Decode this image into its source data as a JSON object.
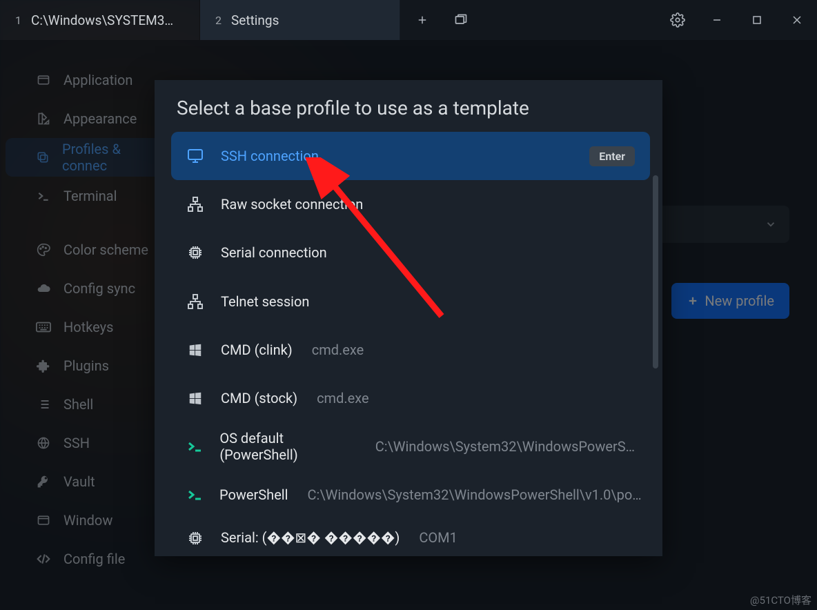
{
  "tabs": [
    {
      "index": "1",
      "label": "C:\\Windows\\SYSTEM3…"
    },
    {
      "index": "2",
      "label": "Settings"
    }
  ],
  "sidebar": {
    "items": [
      {
        "id": "application",
        "label": "Application"
      },
      {
        "id": "appearance",
        "label": "Appearance"
      },
      {
        "id": "profiles",
        "label": "Profiles & connec"
      },
      {
        "id": "terminal",
        "label": "Terminal"
      }
    ],
    "items2": [
      {
        "id": "colorscheme",
        "label": "Color scheme"
      },
      {
        "id": "configsync",
        "label": "Config sync"
      },
      {
        "id": "hotkeys",
        "label": "Hotkeys"
      },
      {
        "id": "plugins",
        "label": "Plugins"
      },
      {
        "id": "shell",
        "label": "Shell"
      },
      {
        "id": "ssh",
        "label": "SSH"
      },
      {
        "id": "vault",
        "label": "Vault"
      },
      {
        "id": "window",
        "label": "Window"
      },
      {
        "id": "configfile",
        "label": "Config file"
      }
    ]
  },
  "content": {
    "new_profile_label": "New profile"
  },
  "modal": {
    "title": "Select a base profile to use as a template",
    "enter_badge": "Enter",
    "profiles": [
      {
        "id": "ssh",
        "label": "SSH connection",
        "sub": "",
        "icon": "monitor"
      },
      {
        "id": "rawsocket",
        "label": "Raw socket connection",
        "sub": "",
        "icon": "network"
      },
      {
        "id": "serial",
        "label": "Serial connection",
        "sub": "",
        "icon": "chip"
      },
      {
        "id": "telnet",
        "label": "Telnet session",
        "sub": "",
        "icon": "network"
      },
      {
        "id": "cmdclink",
        "label": "CMD (clink)",
        "sub": "cmd.exe",
        "icon": "windows"
      },
      {
        "id": "cmdstock",
        "label": "CMD (stock)",
        "sub": "cmd.exe",
        "icon": "windows"
      },
      {
        "id": "osdefault",
        "label": "OS default (PowerShell)",
        "sub": "C:\\Windows\\System32\\WindowsPowerS…",
        "icon": "prompt"
      },
      {
        "id": "powershell",
        "label": "PowerShell",
        "sub": "C:\\Windows\\System32\\WindowsPowerShell\\v1.0\\po…",
        "icon": "prompt"
      },
      {
        "id": "serialcom1",
        "label": "Serial: (��⊠� �����)",
        "sub": "COM1",
        "icon": "chip"
      }
    ]
  },
  "watermark": "@51CTO博客"
}
